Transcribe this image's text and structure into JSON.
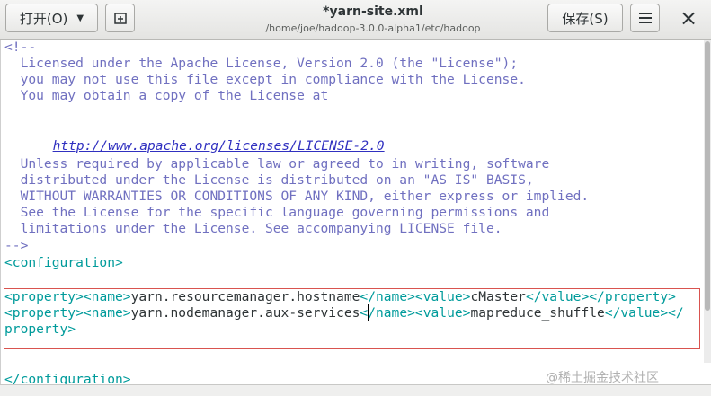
{
  "header": {
    "open_label": "打开(O)",
    "title": "*yarn-site.xml",
    "path": "/home/joe/hadoop-3.0.0-alpha1/etc/hadoop",
    "save_label": "保存(S)",
    "menu_icon": "hamburger-menu-icon",
    "close_icon": "close-icon",
    "newtab_icon": "new-tab-icon"
  },
  "editor": {
    "comment_open": "<!--",
    "license_1": "  Licensed under the Apache License, Version 2.0 (the \"License\");",
    "license_2": "  you may not use this file except in compliance with the License.",
    "license_3": "  You may obtain a copy of the License at",
    "license_url": "http://www.apache.org/licenses/LICENSE-2.0",
    "license_5": "  Unless required by applicable law or agreed to in writing, software",
    "license_6": "  distributed under the License is distributed on an \"AS IS\" BASIS,",
    "license_7": "  WITHOUT WARRANTIES OR CONDITIONS OF ANY KIND, either express or implied.",
    "license_8": "  See the License for the specific language governing permissions and",
    "license_9": "  limitations under the License. See accompanying LICENSE file.",
    "comment_close": "-->",
    "config_open": "<configuration>",
    "config_close": "</configuration>",
    "tag_property_open": "<property>",
    "tag_property_close": "</property>",
    "tag_name_open": "<name>",
    "tag_name_close": "</name>",
    "tag_value_open": "<value>",
    "tag_value_close": "</value>",
    "tag_property_close_part1": "</",
    "tag_property_close_part2": "property>",
    "prop1_name": "yarn.resourcemanager.hostname",
    "prop1_value": "cMaster",
    "prop2_name": "yarn.nodemanager.aux-services",
    "prop2_value": "mapreduce_shuffle"
  },
  "watermark": {
    "text": "@稀土掘金技术社区"
  },
  "colors": {
    "tag": "#009b9b",
    "comment": "#7070c0",
    "highlight_border": "#d9534f"
  }
}
